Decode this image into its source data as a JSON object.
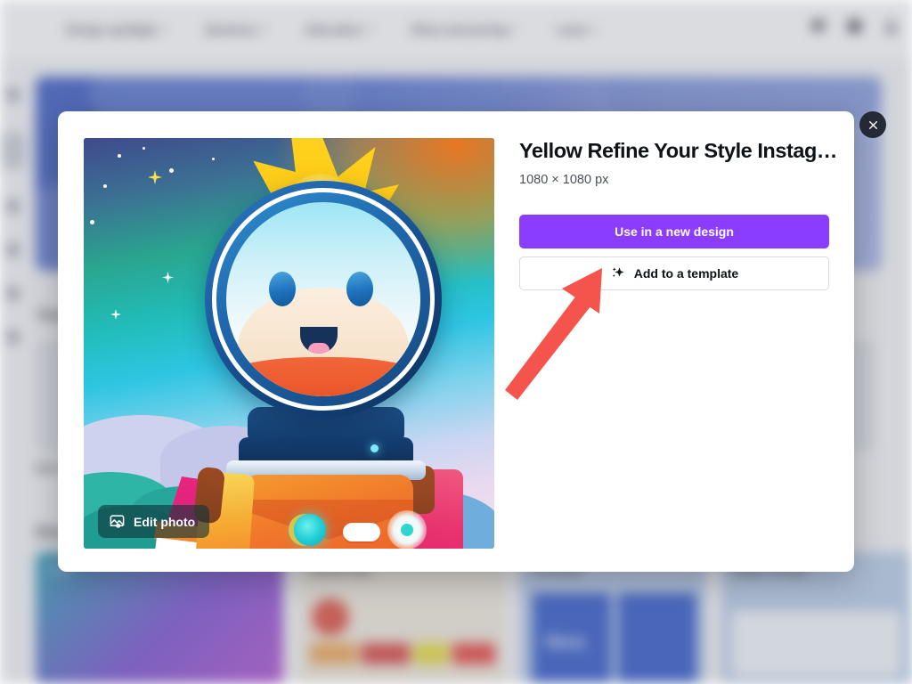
{
  "background_app": {
    "nav_items": [
      {
        "label": "Design spotlight",
        "icon": "chevron-down-icon"
      },
      {
        "label": "Business",
        "icon": "chevron-down-icon"
      },
      {
        "label": "Education",
        "icon": "chevron-down-icon"
      },
      {
        "label": "Plans and pricing",
        "icon": "chevron-down-icon"
      },
      {
        "label": "Learn",
        "icon": "chevron-down-icon"
      }
    ],
    "top_right_icons": [
      "chat-icon",
      "help-icon",
      "account-icon"
    ],
    "sidebar_items": [
      "sidebar-item-1",
      "sidebar-item-2",
      "sidebar-item-3",
      "sidebar-item-4",
      "sidebar-item-5",
      "sidebar-item-6"
    ],
    "sections": [
      {
        "title": "Your designs"
      },
      {
        "title": "Discover"
      }
    ],
    "cards": [
      {
        "label": "Docs"
      },
      {
        "label": "Brand Hub"
      },
      {
        "label": "Translate"
      },
      {
        "label": "New"
      },
      {
        "label": "Magic design"
      }
    ]
  },
  "modal": {
    "close_icon": "close-icon",
    "preview": {
      "alt": "astronaut-illustration",
      "edit_photo_label": "Edit photo",
      "edit_photo_icon": "image-edit-icon"
    },
    "title": "Yellow Refine Your Style Instag…",
    "dimensions": "1080 × 1080 px",
    "primary_button": {
      "label": "Use in a new design",
      "color": "#8B3DFF"
    },
    "secondary_button": {
      "label": "Add to a template",
      "icon": "sparkle-icon"
    }
  },
  "annotation": {
    "arrow_color": "#F4544C",
    "points_to": "add-to-template-button"
  }
}
